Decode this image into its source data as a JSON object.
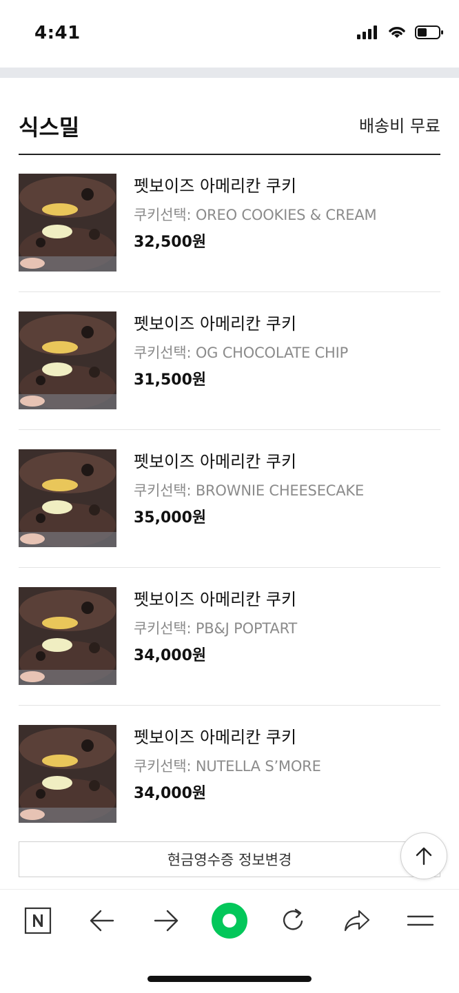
{
  "status_bar": {
    "time": "4:41"
  },
  "store": {
    "name": "식스밀",
    "shipping": "배송비 무료"
  },
  "items": [
    {
      "name": "펫보이즈 아메리칸 쿠키",
      "option": "쿠키선택: OREO COOKIES & CREAM",
      "price": "32,500원"
    },
    {
      "name": "펫보이즈 아메리칸 쿠키",
      "option": "쿠키선택: OG CHOCOLATE CHIP",
      "price": "31,500원"
    },
    {
      "name": "펫보이즈 아메리칸 쿠키",
      "option": "쿠키선택: BROWNIE CHEESECAKE",
      "price": "35,000원"
    },
    {
      "name": "펫보이즈 아메리칸 쿠키",
      "option": "쿠키선택: PB&J POPTART",
      "price": "34,000원"
    },
    {
      "name": "펫보이즈 아메리칸 쿠키",
      "option": "쿠키선택: NUTELLA S’MORE",
      "price": "34,000원"
    }
  ],
  "receipt_button": {
    "label": "현금영수증 정보변경"
  },
  "browser_nav": {
    "icons": [
      "naver-n-icon",
      "back-arrow-icon",
      "forward-arrow-icon",
      "green-home-icon",
      "refresh-icon",
      "share-icon",
      "menu-icon"
    ],
    "accent": "#03c75a"
  }
}
